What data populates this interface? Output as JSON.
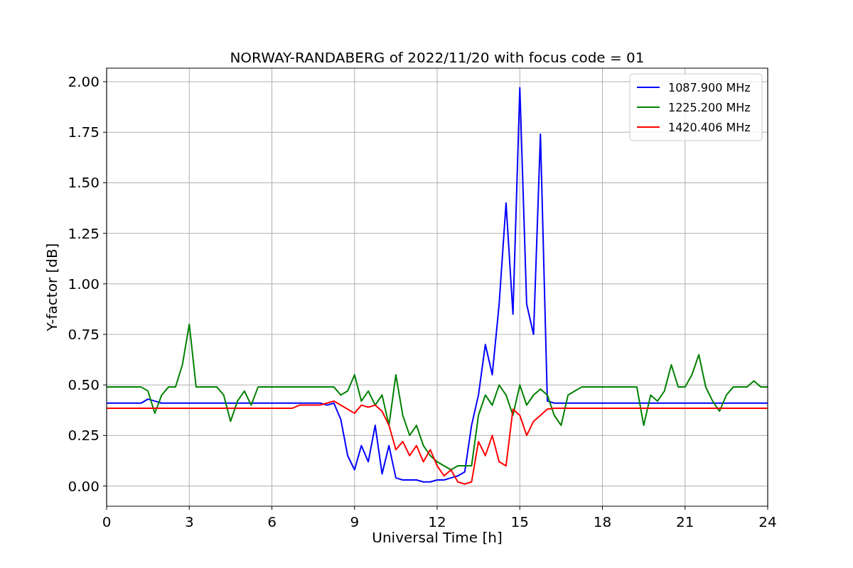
{
  "figure": {
    "chart_data": {
      "type": "line",
      "title": "NORWAY-RANDABERG of 2022/11/20 with focus code = 01",
      "xlabel": "Universal Time [h]",
      "ylabel": "Y-factor [dB]",
      "x": [
        0,
        0.25,
        0.5,
        0.75,
        1,
        1.25,
        1.5,
        1.75,
        2,
        2.25,
        2.5,
        2.75,
        3,
        3.25,
        3.5,
        3.75,
        4,
        4.25,
        4.5,
        4.75,
        5,
        5.25,
        5.5,
        5.75,
        6,
        6.25,
        6.5,
        6.75,
        7,
        7.25,
        7.5,
        7.75,
        8,
        8.25,
        8.5,
        8.75,
        9,
        9.25,
        9.5,
        9.75,
        10,
        10.25,
        10.5,
        10.75,
        11,
        11.25,
        11.5,
        11.75,
        12,
        12.25,
        12.5,
        12.75,
        13,
        13.25,
        13.5,
        13.75,
        14,
        14.25,
        14.5,
        14.75,
        15,
        15.25,
        15.5,
        15.75,
        16,
        16.25,
        16.5,
        16.75,
        17,
        17.25,
        17.5,
        17.75,
        18,
        18.25,
        18.5,
        18.75,
        19,
        19.25,
        19.5,
        19.75,
        20,
        20.25,
        20.5,
        20.75,
        21,
        21.25,
        21.5,
        21.75,
        22,
        22.25,
        22.5,
        22.75,
        23,
        23.25,
        23.5,
        23.75,
        24
      ],
      "series": [
        {
          "name": "1087.900 MHz",
          "color": "#0000ff",
          "values": [
            0.41,
            0.41,
            0.41,
            0.41,
            0.41,
            0.41,
            0.43,
            0.42,
            0.41,
            0.41,
            0.41,
            0.41,
            0.41,
            0.41,
            0.41,
            0.41,
            0.41,
            0.41,
            0.41,
            0.41,
            0.41,
            0.41,
            0.41,
            0.41,
            0.41,
            0.41,
            0.41,
            0.41,
            0.41,
            0.41,
            0.41,
            0.41,
            0.4,
            0.41,
            0.33,
            0.15,
            0.08,
            0.2,
            0.12,
            0.3,
            0.06,
            0.2,
            0.04,
            0.03,
            0.03,
            0.03,
            0.02,
            0.02,
            0.03,
            0.03,
            0.04,
            0.05,
            0.07,
            0.3,
            0.45,
            0.7,
            0.55,
            0.9,
            1.4,
            0.85,
            1.97,
            0.9,
            0.75,
            1.74,
            0.42,
            0.41,
            0.41,
            0.41,
            0.41,
            0.41,
            0.41,
            0.41,
            0.41,
            0.41,
            0.41,
            0.41,
            0.41,
            0.41,
            0.41,
            0.41,
            0.41,
            0.41,
            0.41,
            0.41,
            0.41,
            0.41,
            0.41,
            0.41,
            0.41,
            0.41,
            0.41,
            0.41,
            0.41,
            0.41,
            0.41,
            0.41,
            0.41
          ]
        },
        {
          "name": "1225.200 MHz",
          "color": "#008000",
          "values": [
            0.49,
            0.49,
            0.49,
            0.49,
            0.49,
            0.49,
            0.47,
            0.36,
            0.45,
            0.49,
            0.49,
            0.6,
            0.8,
            0.49,
            0.49,
            0.49,
            0.49,
            0.45,
            0.32,
            0.42,
            0.47,
            0.4,
            0.49,
            0.49,
            0.49,
            0.49,
            0.49,
            0.49,
            0.49,
            0.49,
            0.49,
            0.49,
            0.49,
            0.49,
            0.45,
            0.47,
            0.55,
            0.42,
            0.47,
            0.4,
            0.45,
            0.3,
            0.55,
            0.35,
            0.25,
            0.3,
            0.2,
            0.15,
            0.12,
            0.1,
            0.08,
            0.1,
            0.1,
            0.1,
            0.35,
            0.45,
            0.4,
            0.5,
            0.45,
            0.35,
            0.5,
            0.4,
            0.45,
            0.48,
            0.45,
            0.35,
            0.3,
            0.45,
            0.47,
            0.49,
            0.49,
            0.49,
            0.49,
            0.49,
            0.49,
            0.49,
            0.49,
            0.49,
            0.3,
            0.45,
            0.42,
            0.47,
            0.6,
            0.49,
            0.49,
            0.55,
            0.65,
            0.49,
            0.42,
            0.37,
            0.45,
            0.49,
            0.49,
            0.49,
            0.52,
            0.49,
            0.49
          ]
        },
        {
          "name": "1420.406 MHz",
          "color": "#ff0000",
          "values": [
            0.385,
            0.385,
            0.385,
            0.385,
            0.385,
            0.385,
            0.385,
            0.385,
            0.385,
            0.385,
            0.385,
            0.385,
            0.385,
            0.385,
            0.385,
            0.385,
            0.385,
            0.385,
            0.385,
            0.385,
            0.385,
            0.385,
            0.385,
            0.385,
            0.385,
            0.385,
            0.385,
            0.385,
            0.4,
            0.4,
            0.4,
            0.4,
            0.41,
            0.42,
            0.4,
            0.38,
            0.36,
            0.4,
            0.39,
            0.4,
            0.37,
            0.3,
            0.18,
            0.22,
            0.15,
            0.2,
            0.12,
            0.18,
            0.1,
            0.05,
            0.08,
            0.02,
            0.01,
            0.02,
            0.22,
            0.15,
            0.25,
            0.12,
            0.1,
            0.38,
            0.35,
            0.25,
            0.32,
            0.35,
            0.38,
            0.385,
            0.385,
            0.385,
            0.385,
            0.385,
            0.385,
            0.385,
            0.385,
            0.385,
            0.385,
            0.385,
            0.385,
            0.385,
            0.385,
            0.385,
            0.385,
            0.385,
            0.385,
            0.385,
            0.385,
            0.385,
            0.385,
            0.385,
            0.385,
            0.385,
            0.385,
            0.385,
            0.385,
            0.385,
            0.385,
            0.385,
            0.385
          ]
        }
      ],
      "grid": true,
      "legend": true,
      "xlim": [
        0,
        24
      ],
      "ylim": [
        -0.1,
        2.067
      ],
      "xticks": [
        0,
        3,
        6,
        9,
        12,
        15,
        18,
        21,
        24
      ],
      "yticks": [
        {
          "value": 0,
          "label": "0.00"
        },
        {
          "value": 0.25,
          "label": "0.25"
        },
        {
          "value": 0.5,
          "label": "0.50"
        },
        {
          "value": 0.75,
          "label": "0.75"
        },
        {
          "value": 1,
          "label": "1.00"
        },
        {
          "value": 1.25,
          "label": "1.25"
        },
        {
          "value": 1.5,
          "label": "1.50"
        },
        {
          "value": 1.75,
          "label": "1.75"
        },
        {
          "value": 2,
          "label": "2.00"
        }
      ]
    }
  }
}
